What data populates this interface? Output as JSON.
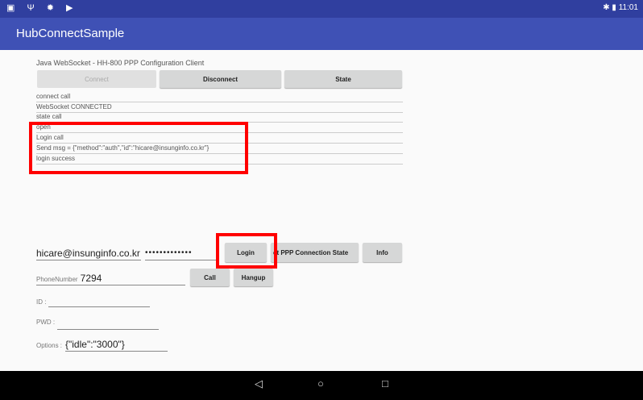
{
  "status_bar": {
    "left_icons": "▣ Ψ ✹ ▶",
    "right_icons": "✱ ▮",
    "time": "11:01"
  },
  "app": {
    "title": "HubConnectSample"
  },
  "client": {
    "title": "Java WebSocket - HH-800 PPP Configuration Client"
  },
  "buttons": {
    "connect": "Connect",
    "disconnect": "Disconnect",
    "state": "State",
    "login": "Login",
    "ppp_state": "et PPP Connection State",
    "info": "Info",
    "call": "Call",
    "hangup": "Hangup"
  },
  "log": [
    "connect call",
    "WebSocket CONNECTED",
    "state call",
    "open",
    "Login call",
    "Send msg = {\"method\":\"auth\",\"id\":\"hicare@insunginfo.co.kr\"}",
    "login success"
  ],
  "inputs": {
    "email": "hicare@insunginfo.co.kr",
    "password": "•••••••••••••",
    "phone_label": "PhoneNumber",
    "phone_value": "7294",
    "id_label": "ID :",
    "id_value": "",
    "pwd_label": "PWD :",
    "pwd_value": "",
    "options_label": "Options :",
    "options_value": "{\"idle\":\"3000\"}"
  },
  "nav": {
    "back": "◁",
    "home": "○",
    "recents": "□"
  },
  "colors": {
    "status_bar": "#303f9f",
    "app_bar": "#3f51b5",
    "highlight": "#ff0000"
  }
}
